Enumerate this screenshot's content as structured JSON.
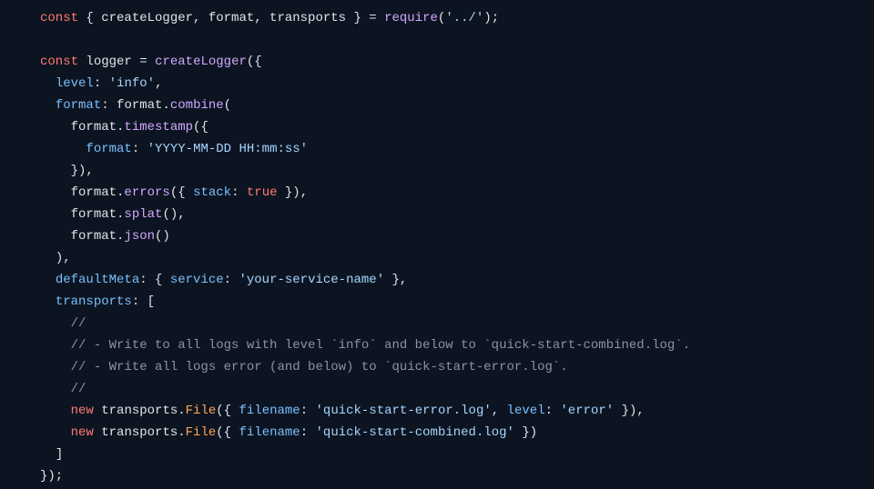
{
  "code": {
    "l1": {
      "const": "const",
      "destr": " { createLogger, format, transports } ",
      "eq": "= ",
      "req": "require",
      "paren1": "(",
      "path": "'../'",
      "paren2": ");"
    },
    "l2": "",
    "l3": {
      "const": "const",
      "sp": " ",
      "logger": "logger",
      "eq": " = ",
      "createLogger": "createLogger",
      "open": "({"
    },
    "l4": {
      "indent": "  ",
      "key": "level",
      "colon": ": ",
      "val": "'info'",
      "comma": ","
    },
    "l5": {
      "indent": "  ",
      "key": "format",
      "colon": ": ",
      "obj": "format.",
      "fn": "combine",
      "open": "("
    },
    "l6": {
      "indent": "    ",
      "obj": "format.",
      "fn": "timestamp",
      "open": "({"
    },
    "l7": {
      "indent": "      ",
      "key": "format",
      "colon": ": ",
      "val": "'YYYY-MM-DD HH:mm:ss'"
    },
    "l8": {
      "indent": "    ",
      "close": "}),"
    },
    "l9": {
      "indent": "    ",
      "obj": "format.",
      "fn": "errors",
      "open": "({ ",
      "key": "stack",
      "colon": ": ",
      "true": "true",
      "close": " }),"
    },
    "l10": {
      "indent": "    ",
      "obj": "format.",
      "fn": "splat",
      "call": "(),"
    },
    "l11": {
      "indent": "    ",
      "obj": "format.",
      "fn": "json",
      "call": "()"
    },
    "l12": {
      "indent": "  ",
      "close": "),"
    },
    "l13": {
      "indent": "  ",
      "key": "defaultMeta",
      "colon": ": { ",
      "key2": "service",
      "colon2": ": ",
      "val": "'your-service-name'",
      "close": " },"
    },
    "l14": {
      "indent": "  ",
      "key": "transports",
      "colon": ": ["
    },
    "l15": {
      "indent": "    ",
      "cmt": "//"
    },
    "l16": {
      "indent": "    ",
      "cmt": "// - Write to all logs with level `info` and below to `quick-start-combined.log`."
    },
    "l17": {
      "indent": "    ",
      "cmt": "// - Write all logs error (and below) to `quick-start-error.log`."
    },
    "l18": {
      "indent": "    ",
      "cmt": "//"
    },
    "l19": {
      "indent": "    ",
      "new": "new",
      "sp": " ",
      "obj": "transports.",
      "cls": "File",
      "open": "({ ",
      "k1": "filename",
      "c1": ": ",
      "v1": "'quick-start-error.log'",
      "comma": ", ",
      "k2": "level",
      "c2": ": ",
      "v2": "'error'",
      "close": " }),"
    },
    "l20": {
      "indent": "    ",
      "new": "new",
      "sp": " ",
      "obj": "transports.",
      "cls": "File",
      "open": "({ ",
      "k1": "filename",
      "c1": ": ",
      "v1": "'quick-start-combined.log'",
      "close": " })"
    },
    "l21": {
      "indent": "  ",
      "close": "]"
    },
    "l22": {
      "close": "});"
    }
  }
}
